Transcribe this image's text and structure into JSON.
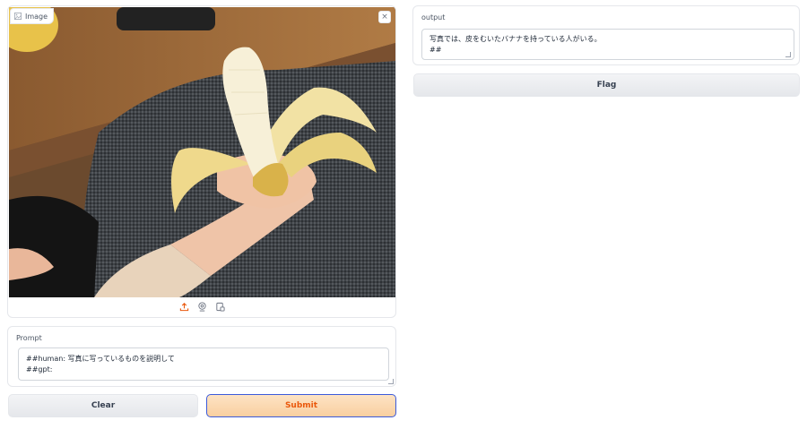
{
  "image_input": {
    "label": "Image",
    "close_glyph": "×",
    "tools": [
      "upload-icon",
      "webcam-icon",
      "clipboard-icon"
    ]
  },
  "prompt": {
    "label": "Prompt",
    "value": "##human: 写真に写っているものを説明して\n##gpt:"
  },
  "buttons": {
    "clear": "Clear",
    "submit": "Submit",
    "flag": "Flag"
  },
  "output": {
    "label": "output",
    "value": "写真では、皮をむいたバナナを持っている人がいる。\n##"
  },
  "colors": {
    "accent": "#ea580c",
    "submit_bg": "#fcd9b3",
    "button_gray": "#e5e7eb"
  }
}
